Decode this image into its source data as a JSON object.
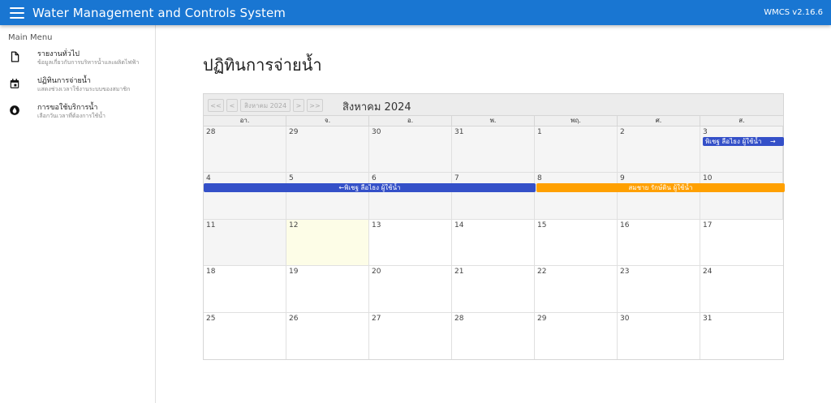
{
  "app": {
    "title": "Water Management and Controls System",
    "version": "WMCS v2.16.6"
  },
  "sidebar": {
    "header": "Main Menu",
    "items": [
      {
        "title": "รายงานทั่วไป",
        "subtitle": "ข้อมูลเกี่ยวกับการบริหารน้ำและผลิตไฟฟ้า",
        "icon": "document-icon"
      },
      {
        "title": "ปฏิทินการจ่ายน้ำ",
        "subtitle": "แสดงช่วงเวลาใช้งานระบบของสมาชิก",
        "icon": "calendar-icon"
      },
      {
        "title": "การขอใช้บริการน้ำ",
        "subtitle": "เลือกวันเวลาที่ต้องการใช้น้ำ",
        "icon": "water-drop-icon"
      }
    ]
  },
  "page": {
    "title": "ปฏิทินการจ่ายน้ำ"
  },
  "calendar": {
    "nav": {
      "prev_year": "<<",
      "prev_month": "<",
      "current": "สิงหาคม 2024",
      "next_month": ">",
      "next_year": ">>"
    },
    "title": "สิงหาคม 2024",
    "weekdays": [
      "อา.",
      "จ.",
      "อ.",
      "พ.",
      "พฤ.",
      "ศ.",
      "ส."
    ],
    "weeks": [
      [
        "28",
        "29",
        "30",
        "31",
        "1",
        "2",
        "3"
      ],
      [
        "4",
        "5",
        "6",
        "7",
        "8",
        "9",
        "10"
      ],
      [
        "11",
        "12",
        "13",
        "14",
        "15",
        "16",
        "17"
      ],
      [
        "18",
        "19",
        "20",
        "21",
        "22",
        "23",
        "24"
      ],
      [
        "25",
        "26",
        "27",
        "28",
        "29",
        "30",
        "31"
      ]
    ],
    "events": [
      {
        "label": "พิเชฐ ลือไธง ผู้ใช้น้ำ",
        "tail": "→"
      },
      {
        "label": "พิเชฐ ลือไธง ผู้ใช้น้ำ",
        "lead": "←"
      },
      {
        "label": "สมชาย รักษ์ดิน ผู้ใช้น้ำ"
      }
    ],
    "colors": {
      "event_blue": "#3450c8",
      "event_orange": "#ffa000",
      "today": "#fdfde7"
    }
  }
}
